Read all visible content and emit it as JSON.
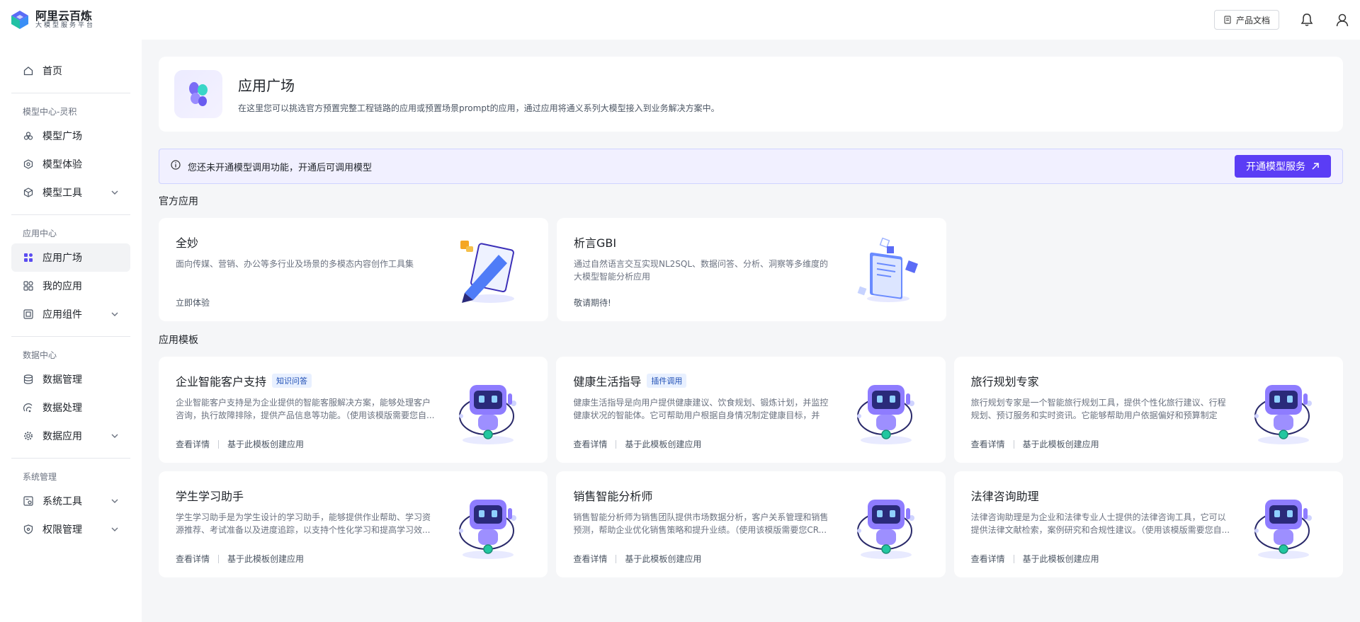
{
  "brand": {
    "title": "阿里云百炼",
    "subtitle": "大模型服务平台"
  },
  "topbar": {
    "doc_button": "产品文档"
  },
  "sidebar": {
    "home": "首页",
    "groups": [
      {
        "title": "模型中心-灵积",
        "items": [
          "模型广场",
          "模型体验",
          "模型工具"
        ]
      },
      {
        "title": "应用中心",
        "items": [
          "应用广场",
          "我的应用",
          "应用组件"
        ]
      },
      {
        "title": "数据中心",
        "items": [
          "数据管理",
          "数据处理",
          "数据应用"
        ]
      },
      {
        "title": "系统管理",
        "items": [
          "系统工具",
          "权限管理"
        ]
      }
    ]
  },
  "hero": {
    "title": "应用广场",
    "desc": "在这里您可以挑选官方预置完整工程链路的应用或预置场景prompt的应用，通过应用将通义系列大模型接入到业务解决方案中。"
  },
  "notice": {
    "text": "您还未开通模型调用功能，开通后可调用模型",
    "button": "开通模型服务"
  },
  "official": {
    "title": "官方应用",
    "cards": [
      {
        "title": "全妙",
        "desc": "面向传媒、营销、办公等多行业及场景的多模态内容创作工具集",
        "action": "立即体验"
      },
      {
        "title": "析言GBI",
        "desc": "通过自然语言交互实现NL2SQL、数据问答、分析、洞察等多维度的大模型智能分析应用",
        "action": "敬请期待!"
      }
    ]
  },
  "templates": {
    "title": "应用模板",
    "detail_label": "查看详情",
    "create_label": "基于此模板创建应用",
    "cards": [
      {
        "title": "企业智能客户支持",
        "tag": "知识问答",
        "desc": "企业智能客户支持是为企业提供的智能客服解决方案，能够处理客户咨询，执行故障排除，提供产品信息等功能。（使用该模版需要您自..."
      },
      {
        "title": "健康生活指导",
        "tag": "插件调用",
        "desc": "健康生活指导是向用户提供健康建议、饮食规划、锻炼计划，并监控健康状况的智能体。它可帮助用户根据自身情况制定健康目标，并跟..."
      },
      {
        "title": "旅行规划专家",
        "tag": "",
        "desc": "旅行规划专家是一个智能旅行规划工具，提供个性化旅行建议、行程规划、预订服务和实时资讯。它能够帮助用户依据偏好和预算制定理..."
      },
      {
        "title": "学生学习助手",
        "tag": "",
        "desc": "学生学习助手是为学生设计的学习助手，能够提供作业帮助、学习资源推荐、考试准备以及进度追踪，以支持个性化学习和提高学习效..."
      },
      {
        "title": "销售智能分析师",
        "tag": "",
        "desc": "销售智能分析师为销售团队提供市场数据分析，客户关系管理和销售预测，帮助企业优化销售策略和提升业绩。（使用该模版需要您CR..."
      },
      {
        "title": "法律咨询助理",
        "tag": "",
        "desc": "法律咨询助理是为企业和法律专业人士提供的法律咨询工具，它可以提供法律文献检索，案例研究和合规性建议。（使用该模版需要您自..."
      }
    ]
  },
  "colors": {
    "accent": "#5b3df5",
    "tag_bg": "#e8f0ff"
  }
}
